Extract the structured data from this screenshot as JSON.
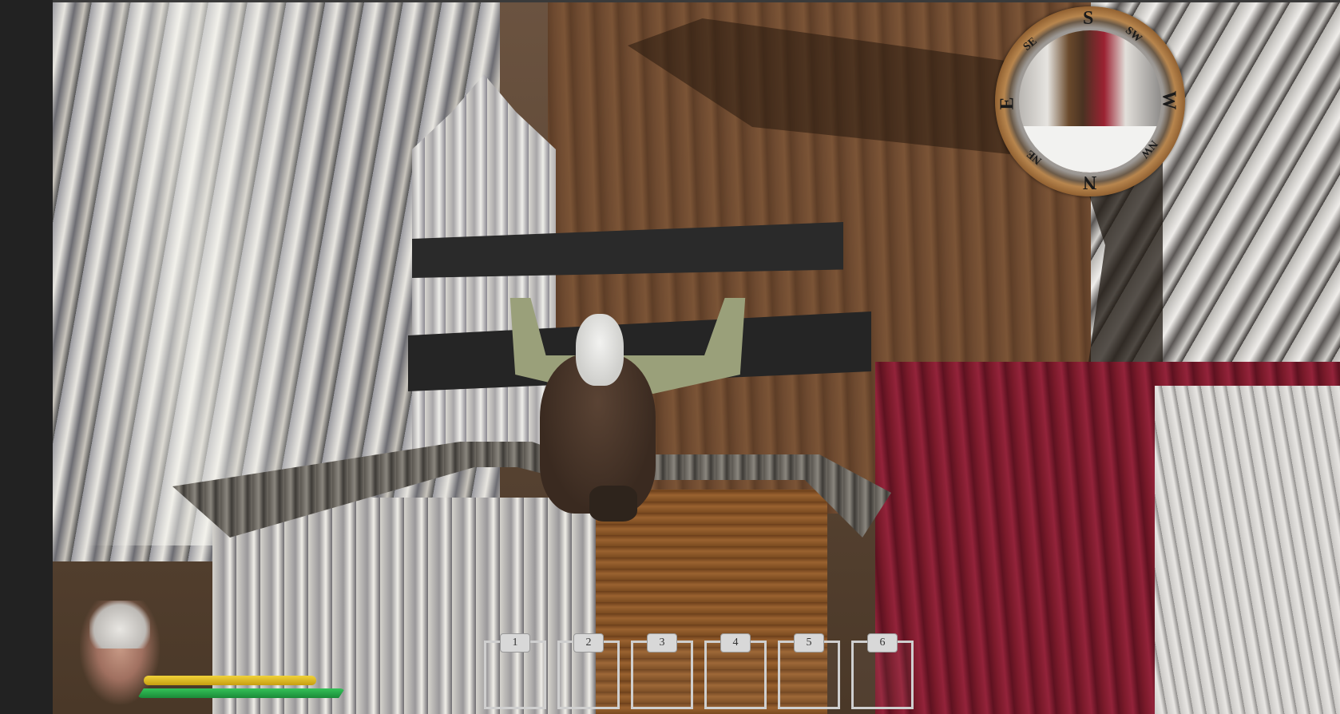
{
  "compass": {
    "north": "N",
    "south": "S",
    "east": "E",
    "west": "W",
    "northeast": "NE",
    "northwest": "NW",
    "southeast": "SE",
    "southwest": "SW"
  },
  "player": {
    "stamina": 0.83,
    "health": 1.0
  },
  "hotbar": {
    "slots": [
      {
        "number": "1"
      },
      {
        "number": "2"
      },
      {
        "number": "3"
      },
      {
        "number": "4"
      },
      {
        "number": "5"
      },
      {
        "number": "6"
      }
    ]
  },
  "colors": {
    "stamina": "#e3c02a",
    "health": "#27a847"
  }
}
